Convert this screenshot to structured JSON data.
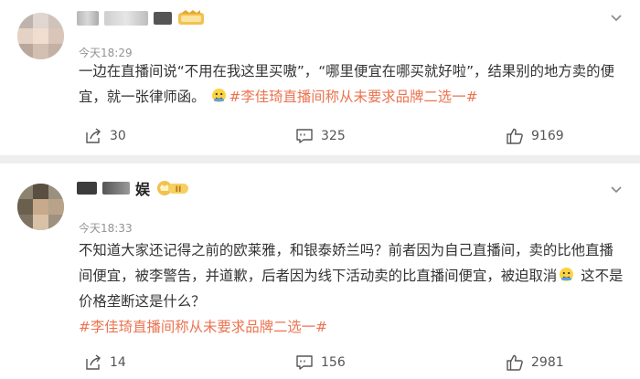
{
  "posts": [
    {
      "name_partial": "",
      "time": "今天18:29",
      "body": "一边在直播间说“不用在我这里买嗷”，“哪里便宜在哪买就好啦”，结果别的地方卖的便宜，就一张律师函。",
      "hashtag": "#李佳琦直播间称从未要求品牌二选一#",
      "shares": "30",
      "comments": "325",
      "likes": "9169"
    },
    {
      "name_partial": "娱",
      "time": "今天18:33",
      "body_a": "不知道大家还记得之前的欧莱雅，和银泰娇兰吗？前者因为自己直播间，卖的比他直播间便宜，被李警告，并道歉，后者因为线下活动卖的比直播间便宜，被迫取消",
      "body_b": " 这不是价格垄断这是什么？",
      "hashtag": "#李佳琦直播间称从未要求品牌二选一#",
      "shares": "14",
      "comments": "156",
      "likes": "2981"
    }
  ],
  "colors": {
    "hashtag": "#eb7350",
    "time": "#939393",
    "divider": "#eeeeee"
  },
  "icons": [
    "more-icon",
    "share-icon",
    "comment-icon",
    "like-icon",
    "emoji-icon",
    "vip-badge-icon"
  ]
}
